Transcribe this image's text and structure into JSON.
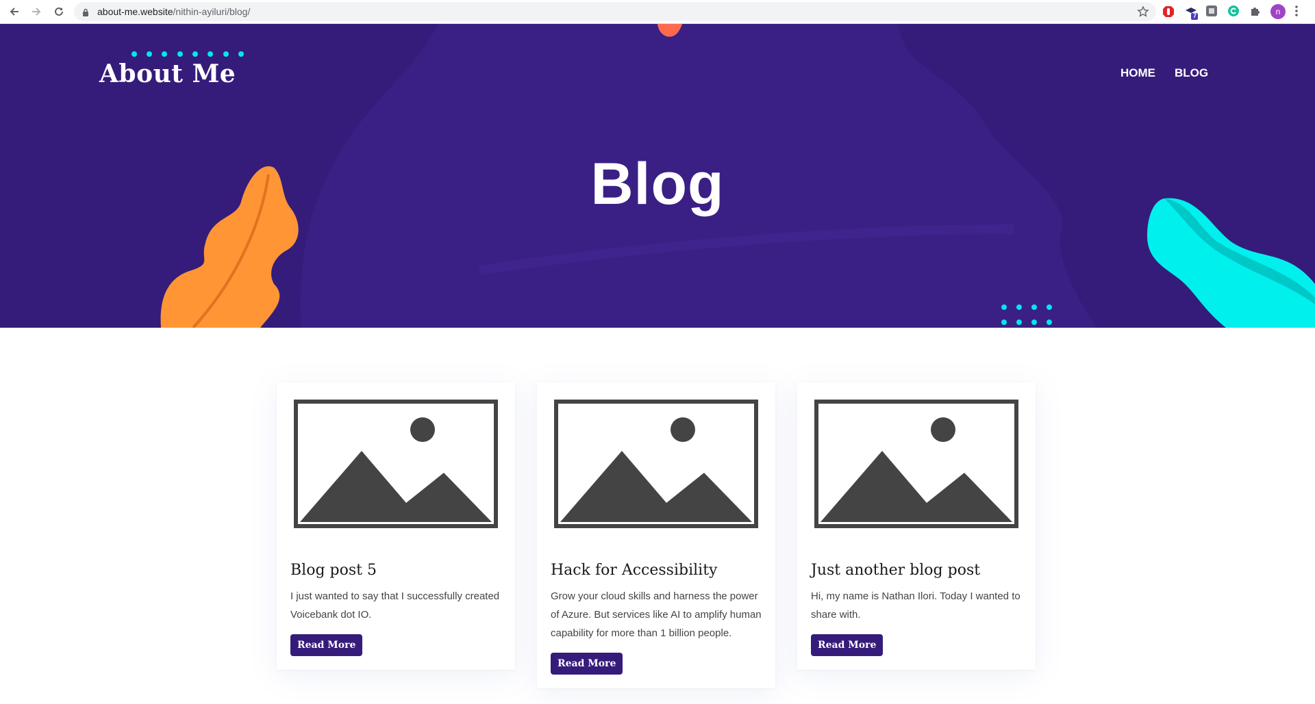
{
  "browser": {
    "url_host": "about-me.website",
    "url_path": "/nithin-ayiluri/blog/",
    "extension_badge": "7",
    "profile_initial": "n"
  },
  "site": {
    "brand": "About Me",
    "nav": [
      {
        "label": "HOME"
      },
      {
        "label": "BLOG"
      }
    ],
    "hero_title": "Blog"
  },
  "posts": [
    {
      "title": "Blog post 5",
      "excerpt": "I just wanted to say that I successfully created Voicebank dot IO.",
      "button": "Read More"
    },
    {
      "title": "Hack for Accessibility",
      "excerpt": "Grow your cloud skills and harness the power of Azure. But services like AI to amplify human capability for more than 1 billion people.",
      "button": "Read More"
    },
    {
      "title": "Just another blog post",
      "excerpt": "Hi, my name is Nathan Ilori. Today I wanted to share with.",
      "button": "Read More"
    }
  ],
  "colors": {
    "hero_bg": "#351c7b",
    "accent_orange": "#ff9535",
    "accent_cyan": "#00f0ee",
    "button_bg": "#351c7b"
  },
  "icons": [
    "back-arrow-icon",
    "forward-arrow-icon",
    "reload-icon",
    "lock-icon",
    "star-icon",
    "image-placeholder-icon"
  ]
}
